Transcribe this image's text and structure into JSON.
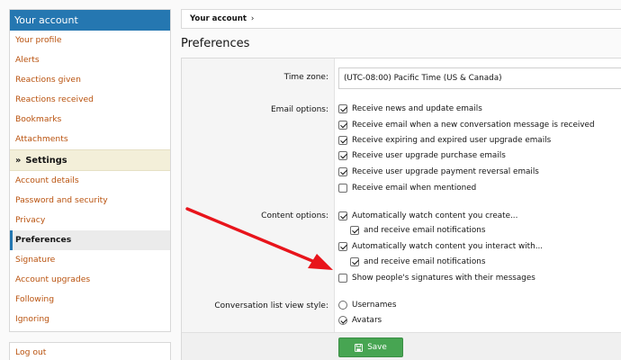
{
  "sidebar": {
    "header": "Your account",
    "items_top": [
      {
        "label": "Your profile"
      },
      {
        "label": "Alerts"
      },
      {
        "label": "Reactions given"
      },
      {
        "label": "Reactions received"
      },
      {
        "label": "Bookmarks"
      },
      {
        "label": "Attachments"
      }
    ],
    "section": {
      "label": "Settings",
      "icon": "double-chevron-right-icon"
    },
    "items_settings": [
      {
        "label": "Account details"
      },
      {
        "label": "Password and security"
      },
      {
        "label": "Privacy"
      },
      {
        "label": "Preferences",
        "selected": true
      },
      {
        "label": "Signature"
      },
      {
        "label": "Account upgrades"
      },
      {
        "label": "Following"
      },
      {
        "label": "Ignoring"
      }
    ],
    "logout": "Log out"
  },
  "breadcrumb": {
    "label": "Your account",
    "separator": "›"
  },
  "page_title": "Preferences",
  "form": {
    "timezone": {
      "label": "Time zone:",
      "value": "(UTC-08:00) Pacific Time (US & Canada)"
    },
    "email_options": {
      "label": "Email options:",
      "items": [
        {
          "label": "Receive news and update emails",
          "checked": true
        },
        {
          "label": "Receive email when a new conversation message is received",
          "checked": true
        },
        {
          "label": "Receive expiring and expired user upgrade emails",
          "checked": true
        },
        {
          "label": "Receive user upgrade purchase emails",
          "checked": true
        },
        {
          "label": "Receive user upgrade payment reversal emails",
          "checked": true
        },
        {
          "label": "Receive email when mentioned",
          "checked": false
        }
      ]
    },
    "content_options": {
      "label": "Content options:",
      "items": [
        {
          "label": "Automatically watch content you create...",
          "checked": true
        },
        {
          "label": "and receive email notifications",
          "checked": true
        },
        {
          "label": "Automatically watch content you interact with...",
          "checked": true
        },
        {
          "label": "and receive email notifications",
          "checked": true
        },
        {
          "label": "Show people's signatures with their messages",
          "checked": false
        }
      ]
    },
    "conversation_view": {
      "label": "Conversation list view style:",
      "options": [
        {
          "label": "Usernames",
          "checked": false
        },
        {
          "label": "Avatars",
          "checked": true
        }
      ]
    },
    "save_label": "Save"
  },
  "colors": {
    "header_blue": "#2577b1",
    "link_orange": "#b9520e",
    "section_bg": "#f3efd9",
    "save_green": "#47a552",
    "annotation_red": "#e8141b"
  }
}
